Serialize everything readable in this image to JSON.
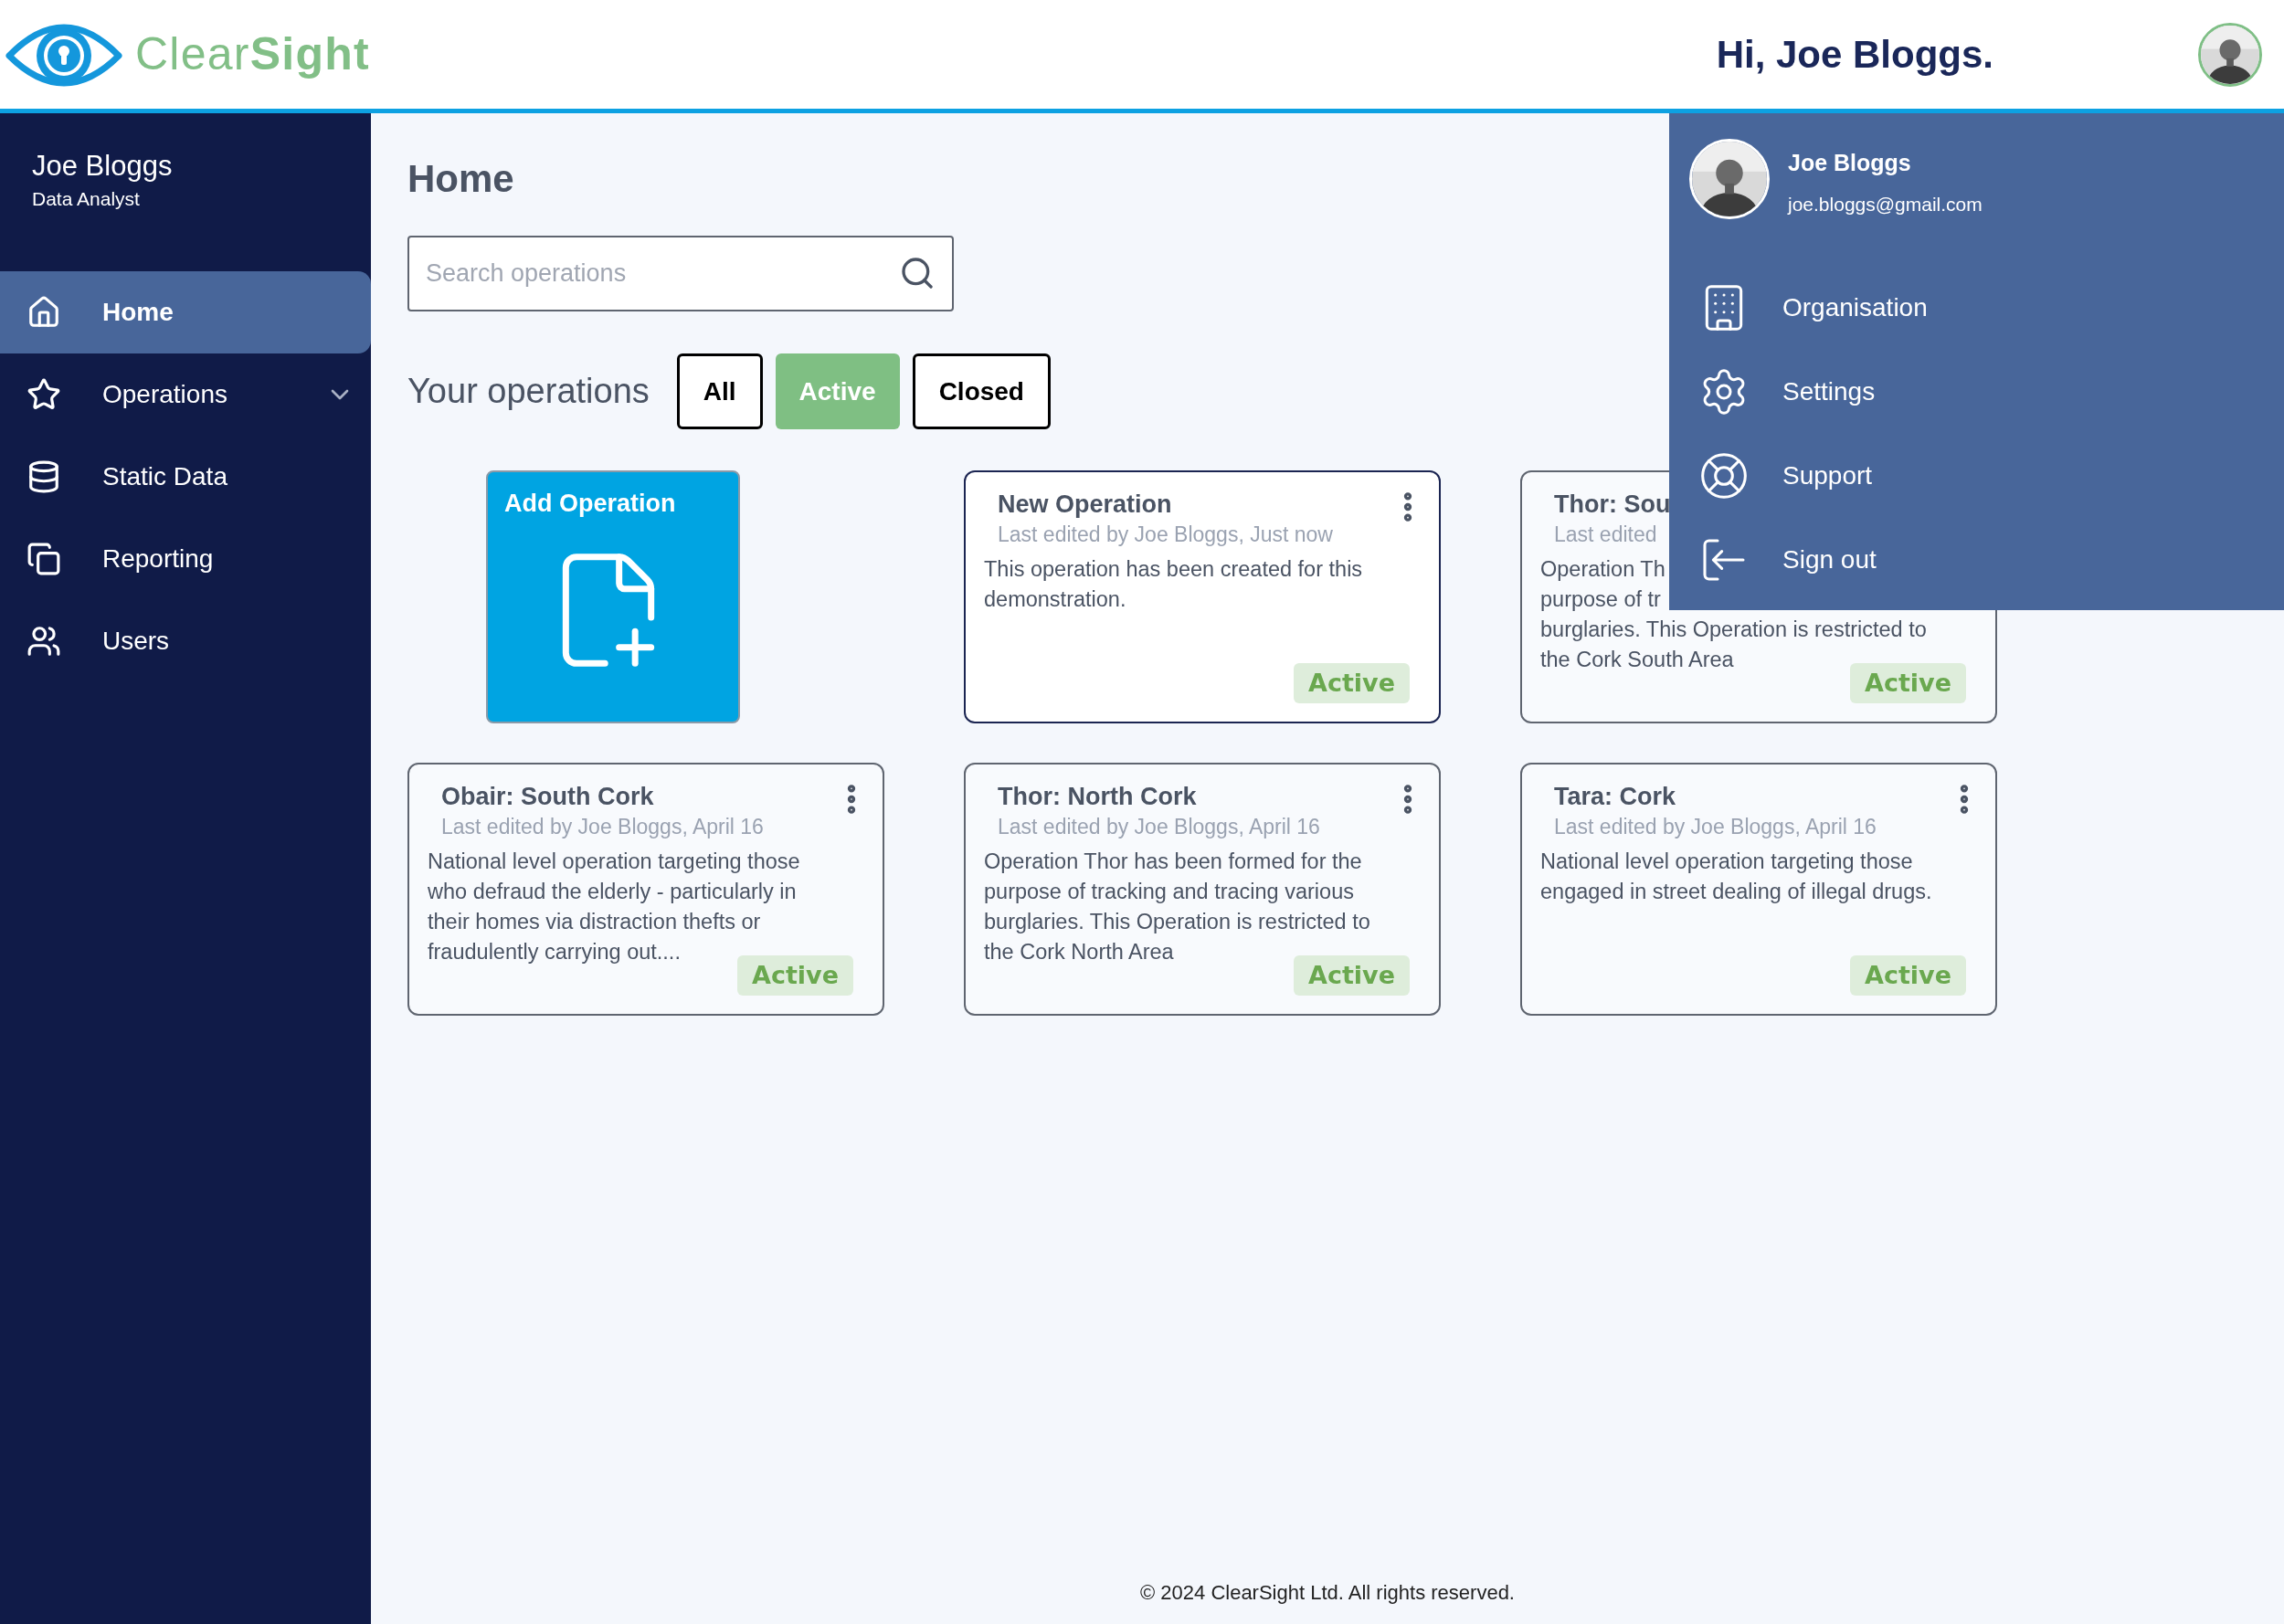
{
  "header": {
    "logo_text": "Clear**Sight**",
    "greeting": "Hi, Joe Bloggs."
  },
  "sidebar": {
    "user_name": "Joe Bloggs",
    "user_role": "Data Analyst",
    "items": [
      {
        "label": "Home",
        "selected": true,
        "has_submenu": false
      },
      {
        "label": "Operations",
        "selected": false,
        "has_submenu": true
      },
      {
        "label": "Static Data",
        "selected": false,
        "has_submenu": false
      },
      {
        "label": "Reporting",
        "selected": false,
        "has_submenu": false
      },
      {
        "label": "Users",
        "selected": false,
        "has_submenu": false
      }
    ]
  },
  "page": {
    "title": "Home",
    "search": {
      "placeholder": "Search operations"
    },
    "filter_label": "Your operations",
    "filters": [
      {
        "label": "All",
        "selected": false
      },
      {
        "label": "Active",
        "selected": true
      },
      {
        "label": "Closed",
        "selected": false
      }
    ],
    "add_card": {
      "label": "Add Operation"
    },
    "operations": [
      {
        "title": "New Operation",
        "meta": "Last edited by Joe Bloggs, Just now",
        "lines": [
          "This operation has been created for this",
          "demonstration."
        ],
        "status": "Active",
        "menu": true,
        "highlighted": true
      },
      {
        "title": "Thor: Sou",
        "meta": "Last edited",
        "lines": [
          "Operation Th",
          "purpose of tr",
          "burglaries. This Operation is restricted to",
          "the Cork South Area"
        ],
        "status": "Active",
        "highlighted": false
      },
      {
        "title": "Obair: South Cork",
        "meta": "Last edited by Joe Bloggs, April 16",
        "lines": [
          "National level operation targeting those",
          "who defraud the elderly - particularly in",
          "their homes via distraction thefts or",
          "fraudulently carrying out...."
        ],
        "status": "Active",
        "menu": true,
        "highlighted": false
      },
      {
        "title": "Thor: North Cork",
        "meta": "Last edited by Joe Bloggs, April 16",
        "lines": [
          "Operation Thor has been formed for the",
          "purpose of tracking and tracing various",
          "burglaries. This Operation is restricted to",
          "the Cork North Area"
        ],
        "status": "Active",
        "menu": true,
        "highlighted": false
      },
      {
        "title": "Tara: Cork",
        "meta": "Last edited by Joe Bloggs, April 16",
        "lines": [
          "National level operation targeting those",
          "engaged in street dealing of illegal drugs."
        ],
        "status": "Active",
        "menu": true,
        "highlighted": false
      }
    ],
    "footer": "© 2024 ClearSight Ltd. All rights reserved."
  },
  "user_menu": {
    "name": "Joe Bloggs",
    "email": "joe.bloggs@gmail.com",
    "items": [
      {
        "label": "Organisation"
      },
      {
        "label": "Settings"
      },
      {
        "label": "Support"
      },
      {
        "label": "Sign out"
      }
    ]
  }
}
